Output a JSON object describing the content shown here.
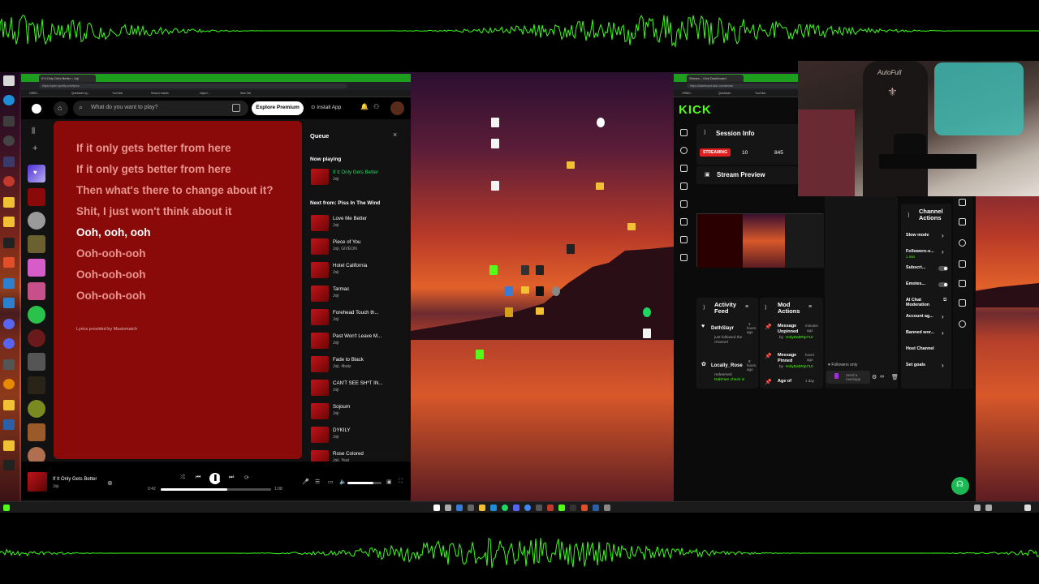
{
  "spotify": {
    "tab_title": "If It Only Gets Better • Joji",
    "url": "https://open.spotify.com/lyrics",
    "search_placeholder": "What do you want to play?",
    "explore_label": "Explore Premium",
    "install_label": "Install App",
    "lyrics": [
      {
        "text": "If it only gets better from here",
        "active": false
      },
      {
        "text": "If it only gets better from here",
        "active": false
      },
      {
        "text": "Then what's there to change about it?",
        "active": false
      },
      {
        "text": "Shit, I just won't think about it",
        "active": false
      },
      {
        "text": "Ooh, ooh, ooh",
        "active": true
      },
      {
        "text": "Ooh-ooh-ooh",
        "active": false
      },
      {
        "text": "Ooh-ooh-ooh",
        "active": false
      },
      {
        "text": "Ooh-ooh-ooh",
        "active": false
      }
    ],
    "lyrics_credit": "Lyrics provided by Musixmatch",
    "queue": {
      "title": "Queue",
      "now_playing_label": "Now playing",
      "now_playing": {
        "name": "If It Only Gets Better",
        "artist": "Joji"
      },
      "next_from_label": "Next from: Piss In The Wind",
      "items": [
        {
          "name": "Love Me Better",
          "artist": "Joji"
        },
        {
          "name": "Piece of You",
          "artist": "Joji, GIVĒON"
        },
        {
          "name": "Hotel California",
          "artist": "Joji"
        },
        {
          "name": "Tarmac",
          "artist": "Joji"
        },
        {
          "name": "Forehead Touch th...",
          "artist": "Joji"
        },
        {
          "name": "Past Won't Leave M...",
          "artist": "Joji"
        },
        {
          "name": "Fade to Black",
          "artist": "Joji, 4batz"
        },
        {
          "name": "CAN'T SEE SH*T IN...",
          "artist": "Joji"
        },
        {
          "name": "Sojourn",
          "artist": "Joji"
        },
        {
          "name": "DYKILY",
          "artist": "Joji"
        },
        {
          "name": "Rose Colored",
          "artist": "Joji, Yeat"
        }
      ]
    },
    "player": {
      "track": "If It Only Gets Better",
      "artist": "Joji",
      "elapsed": "0:42",
      "duration": "1:08",
      "progress": 0.6,
      "volume": 0.75
    }
  },
  "kick": {
    "tab_title": "Stream – Kick Dashboard",
    "url": "https://dashboard.kick.com/stream",
    "logo": "KICK",
    "session_info": {
      "title": "Session Info",
      "status": "STREAMING",
      "viewers": "10",
      "followers": "845"
    },
    "stream_preview_title": "Stream Preview",
    "activity_feed": {
      "title_line1": "Activity",
      "title_line2": "Feed",
      "items": [
        {
          "user": "DethSlayr",
          "time_l1": "3",
          "time_l2": "hours",
          "time_l3": "ago",
          "desc_l1": "just followed the",
          "desc_l2": "channel",
          "desc_l3": ""
        },
        {
          "user": "Locally_Rose",
          "time_l1": "8",
          "time_l2": "hours",
          "time_l3": "ago",
          "desc_l1": "redeemed",
          "desc_l2": "DabFam check in",
          "desc_l3": ""
        }
      ]
    },
    "mod_actions": {
      "title_line1": "Mod",
      "title_line2": "Actions",
      "items": [
        {
          "action_l1": "Message",
          "action_l2": "Unpinned",
          "time_l1": "minutes",
          "time_l2": "ago",
          "by": "by",
          "user": "HolyDabRip710"
        },
        {
          "action_l1": "Message",
          "action_l2": "Pinned",
          "time_l1": "hours",
          "time_l2": "ago",
          "by": "by",
          "user": "HolyDabRip710"
        },
        {
          "action_l1": "Age of",
          "action_l2": "",
          "time_l1": "1 day",
          "time_l2": "",
          "by": "",
          "user": ""
        }
      ]
    },
    "chat": {
      "followers_only": "Followers only",
      "send_placeholder": "Send a message"
    },
    "channel_actions": {
      "title_line1": "Channel",
      "title_line2": "Actions",
      "items": [
        {
          "label": "Slow mode",
          "control": "chevron",
          "sub": ""
        },
        {
          "label": "Followers-o...",
          "control": "chevron",
          "sub": "1 min"
        },
        {
          "label": "Subscri...",
          "control": "toggle",
          "sub": ""
        },
        {
          "label": "Emotes...",
          "control": "toggle",
          "sub": ""
        },
        {
          "label": "AI Chat Moderation",
          "control": "external",
          "sub": ""
        },
        {
          "label": "Account ag...",
          "control": "chevron",
          "sub": ""
        },
        {
          "label": "Banned wor...",
          "control": "chevron",
          "sub": ""
        },
        {
          "label": "Host Channel",
          "control": "none",
          "sub": ""
        },
        {
          "label": "Set goals",
          "control": "chevron",
          "sub": ""
        }
      ]
    }
  },
  "colors": {
    "spotify_green": "#1ed760",
    "kick_green": "#53fc18",
    "lyrics_bg": "#8a0a0a",
    "streaming_red": "#e02020"
  }
}
